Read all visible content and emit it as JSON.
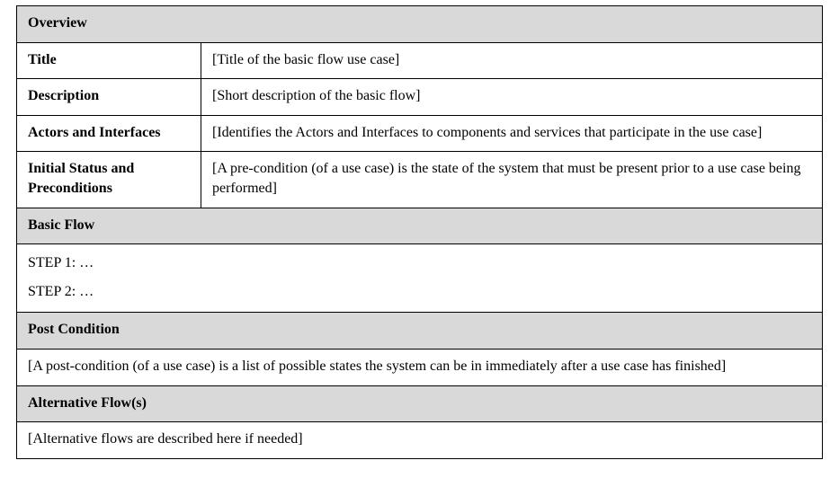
{
  "overview": {
    "header": "Overview",
    "title_label": "Title",
    "title_value": "[Title of the basic flow use case]",
    "description_label": "Description",
    "description_value": "[Short description of the basic flow]",
    "actors_label": "Actors and Interfaces",
    "actors_value": "[Identifies the Actors and Interfaces to components and services that participate in the use case]",
    "initial_label": "Initial Status and Preconditions",
    "initial_value": "[A pre-condition (of a use case) is the state of the system that must be present prior to a use case being performed]"
  },
  "basic_flow": {
    "header": "Basic Flow",
    "step1": "STEP 1: …",
    "step2": "STEP 2: …"
  },
  "post_condition": {
    "header": "Post Condition",
    "value": "[A post-condition (of a use case) is a list of possible states the system can be in immediately after a use case has finished]"
  },
  "alternative_flow": {
    "header": "Alternative Flow(s)",
    "value": "[Alternative flows are described here if needed]"
  }
}
